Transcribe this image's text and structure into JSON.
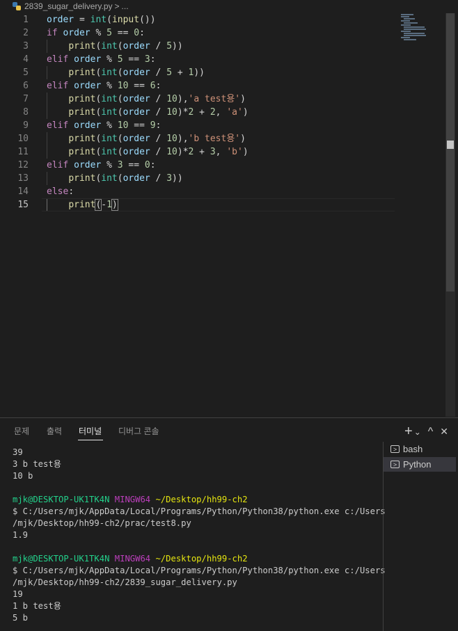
{
  "breadcrumb": {
    "filename": "2839_sugar_delivery.py",
    "separator": ">",
    "more": "..."
  },
  "editor": {
    "active_line": "15",
    "lines": [
      {
        "n": "1",
        "tokens": [
          [
            "var",
            "order"
          ],
          [
            "op",
            " = "
          ],
          [
            "ty",
            "int"
          ],
          [
            "op",
            "("
          ],
          [
            "fn",
            "input"
          ],
          [
            "op",
            "())"
          ]
        ]
      },
      {
        "n": "2",
        "tokens": [
          [
            "kw",
            "if"
          ],
          [
            "op",
            " "
          ],
          [
            "var",
            "order"
          ],
          [
            "op",
            " % "
          ],
          [
            "num",
            "5"
          ],
          [
            "op",
            " == "
          ],
          [
            "num",
            "0"
          ],
          [
            "op",
            ":"
          ]
        ]
      },
      {
        "n": "3",
        "tokens": [
          [
            "op",
            "    "
          ],
          [
            "fn",
            "print"
          ],
          [
            "op",
            "("
          ],
          [
            "ty",
            "int"
          ],
          [
            "op",
            "("
          ],
          [
            "var",
            "order"
          ],
          [
            "op",
            " / "
          ],
          [
            "num",
            "5"
          ],
          [
            "op",
            "))"
          ]
        ]
      },
      {
        "n": "4",
        "tokens": [
          [
            "kw",
            "elif"
          ],
          [
            "op",
            " "
          ],
          [
            "var",
            "order"
          ],
          [
            "op",
            " % "
          ],
          [
            "num",
            "5"
          ],
          [
            "op",
            " == "
          ],
          [
            "num",
            "3"
          ],
          [
            "op",
            ":"
          ]
        ]
      },
      {
        "n": "5",
        "tokens": [
          [
            "op",
            "    "
          ],
          [
            "fn",
            "print"
          ],
          [
            "op",
            "("
          ],
          [
            "ty",
            "int"
          ],
          [
            "op",
            "("
          ],
          [
            "var",
            "order"
          ],
          [
            "op",
            " / "
          ],
          [
            "num",
            "5"
          ],
          [
            "op",
            " + "
          ],
          [
            "num",
            "1"
          ],
          [
            "op",
            "))"
          ]
        ]
      },
      {
        "n": "6",
        "tokens": [
          [
            "kw",
            "elif"
          ],
          [
            "op",
            " "
          ],
          [
            "var",
            "order"
          ],
          [
            "op",
            " % "
          ],
          [
            "num",
            "10"
          ],
          [
            "op",
            " == "
          ],
          [
            "num",
            "6"
          ],
          [
            "op",
            ":"
          ]
        ]
      },
      {
        "n": "7",
        "tokens": [
          [
            "op",
            "    "
          ],
          [
            "fn",
            "print"
          ],
          [
            "op",
            "("
          ],
          [
            "ty",
            "int"
          ],
          [
            "op",
            "("
          ],
          [
            "var",
            "order"
          ],
          [
            "op",
            " / "
          ],
          [
            "num",
            "10"
          ],
          [
            "op",
            "),"
          ],
          [
            "str",
            "'a test용'"
          ],
          [
            "op",
            ")"
          ]
        ]
      },
      {
        "n": "8",
        "tokens": [
          [
            "op",
            "    "
          ],
          [
            "fn",
            "print"
          ],
          [
            "op",
            "("
          ],
          [
            "ty",
            "int"
          ],
          [
            "op",
            "("
          ],
          [
            "var",
            "order"
          ],
          [
            "op",
            " / "
          ],
          [
            "num",
            "10"
          ],
          [
            "op",
            ")*"
          ],
          [
            "num",
            "2"
          ],
          [
            "op",
            " + "
          ],
          [
            "num",
            "2"
          ],
          [
            "op",
            ", "
          ],
          [
            "str",
            "'a'"
          ],
          [
            "op",
            ")"
          ]
        ]
      },
      {
        "n": "9",
        "tokens": [
          [
            "kw",
            "elif"
          ],
          [
            "op",
            " "
          ],
          [
            "var",
            "order"
          ],
          [
            "op",
            " % "
          ],
          [
            "num",
            "10"
          ],
          [
            "op",
            " == "
          ],
          [
            "num",
            "9"
          ],
          [
            "op",
            ":"
          ]
        ]
      },
      {
        "n": "10",
        "tokens": [
          [
            "op",
            "    "
          ],
          [
            "fn",
            "print"
          ],
          [
            "op",
            "("
          ],
          [
            "ty",
            "int"
          ],
          [
            "op",
            "("
          ],
          [
            "var",
            "order"
          ],
          [
            "op",
            " / "
          ],
          [
            "num",
            "10"
          ],
          [
            "op",
            "),"
          ],
          [
            "str",
            "'b test용'"
          ],
          [
            "op",
            ")"
          ]
        ]
      },
      {
        "n": "11",
        "tokens": [
          [
            "op",
            "    "
          ],
          [
            "fn",
            "print"
          ],
          [
            "op",
            "("
          ],
          [
            "ty",
            "int"
          ],
          [
            "op",
            "("
          ],
          [
            "var",
            "order"
          ],
          [
            "op",
            " / "
          ],
          [
            "num",
            "10"
          ],
          [
            "op",
            ")*"
          ],
          [
            "num",
            "2"
          ],
          [
            "op",
            " + "
          ],
          [
            "num",
            "3"
          ],
          [
            "op",
            ", "
          ],
          [
            "str",
            "'b'"
          ],
          [
            "op",
            ")"
          ]
        ]
      },
      {
        "n": "12",
        "tokens": [
          [
            "kw",
            "elif"
          ],
          [
            "op",
            " "
          ],
          [
            "var",
            "order"
          ],
          [
            "op",
            " % "
          ],
          [
            "num",
            "3"
          ],
          [
            "op",
            " == "
          ],
          [
            "num",
            "0"
          ],
          [
            "op",
            ":"
          ]
        ]
      },
      {
        "n": "13",
        "tokens": [
          [
            "op",
            "    "
          ],
          [
            "fn",
            "print"
          ],
          [
            "op",
            "("
          ],
          [
            "ty",
            "int"
          ],
          [
            "op",
            "("
          ],
          [
            "var",
            "order"
          ],
          [
            "op",
            " / "
          ],
          [
            "num",
            "3"
          ],
          [
            "op",
            "))"
          ]
        ]
      },
      {
        "n": "14",
        "tokens": [
          [
            "kw",
            "else"
          ],
          [
            "op",
            ":"
          ]
        ]
      },
      {
        "n": "15",
        "tokens": [
          [
            "op",
            "    "
          ],
          [
            "fn",
            "print"
          ],
          [
            "bracket",
            "("
          ],
          [
            "op",
            "-"
          ],
          [
            "num",
            "1"
          ],
          [
            "bracket",
            ")"
          ]
        ]
      }
    ]
  },
  "panel": {
    "tabs": [
      {
        "label": "문제",
        "active": false
      },
      {
        "label": "출력",
        "active": false
      },
      {
        "label": "터미널",
        "active": true
      },
      {
        "label": "디버그 콘솔",
        "active": false
      }
    ],
    "actions": {
      "add": "+",
      "dropdown": "⌄",
      "maximize": "^",
      "close": "✕"
    }
  },
  "terminal": {
    "lines": [
      [
        [
          "plain",
          "39"
        ]
      ],
      [
        [
          "plain",
          "3 b test용"
        ]
      ],
      [
        [
          "plain",
          "10 b"
        ]
      ],
      [
        [
          "plain",
          ""
        ]
      ],
      [
        [
          "user",
          "mjk@DESKTOP-UK1TK4N"
        ],
        [
          "plain",
          " "
        ],
        [
          "ming",
          "MINGW64"
        ],
        [
          "plain",
          " "
        ],
        [
          "path",
          "~/Desktop/hh99-ch2"
        ]
      ],
      [
        [
          "plain",
          "$ C:/Users/mjk/AppData/Local/Programs/Python/Python38/python.exe c:/Users"
        ]
      ],
      [
        [
          "plain",
          "/mjk/Desktop/hh99-ch2/prac/test8.py"
        ]
      ],
      [
        [
          "plain",
          "1.9"
        ]
      ],
      [
        [
          "plain",
          ""
        ]
      ],
      [
        [
          "user",
          "mjk@DESKTOP-UK1TK4N"
        ],
        [
          "plain",
          " "
        ],
        [
          "ming",
          "MINGW64"
        ],
        [
          "plain",
          " "
        ],
        [
          "path",
          "~/Desktop/hh99-ch2"
        ]
      ],
      [
        [
          "plain",
          "$ C:/Users/mjk/AppData/Local/Programs/Python/Python38/python.exe c:/Users"
        ]
      ],
      [
        [
          "plain",
          "/mjk/Desktop/hh99-ch2/2839_sugar_delivery.py"
        ]
      ],
      [
        [
          "plain",
          "19"
        ]
      ],
      [
        [
          "plain",
          "1 b test용"
        ]
      ],
      [
        [
          "plain",
          "5 b"
        ]
      ]
    ],
    "sessions": [
      {
        "label": "bash",
        "selected": false
      },
      {
        "label": "Python",
        "selected": true
      }
    ]
  },
  "colors": {
    "background": "#1e1e1e",
    "keyword": "#c586c0",
    "variable": "#9cdcfe",
    "function": "#dcdcaa",
    "type": "#4ec9b0",
    "number": "#b5cea8",
    "string": "#ce9178"
  }
}
